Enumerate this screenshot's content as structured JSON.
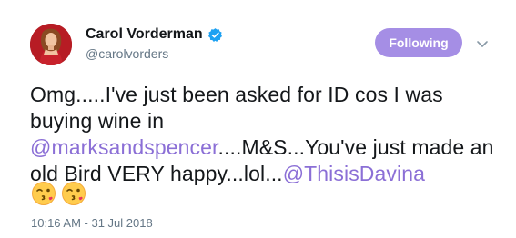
{
  "author": {
    "display_name": "Carol Vorderman",
    "handle": "@carolvorders",
    "verified": true,
    "verified_color": "#1da1f2"
  },
  "follow_button": {
    "label": "Following",
    "color": "#a58ee5"
  },
  "tweet": {
    "text_parts": [
      "Omg.....I've just been asked for ID cos I was buying wine in ",
      "@marksandspencer",
      "....M&S...You've just made an old Bird VERY happy...lol...",
      "@ThisisDavina"
    ],
    "mention_color": "#8b6fd6",
    "emojis": [
      "face-throwing-kiss-icon",
      "face-throwing-kiss-icon"
    ],
    "timestamp": "10:16 AM - 31 Jul 2018"
  }
}
